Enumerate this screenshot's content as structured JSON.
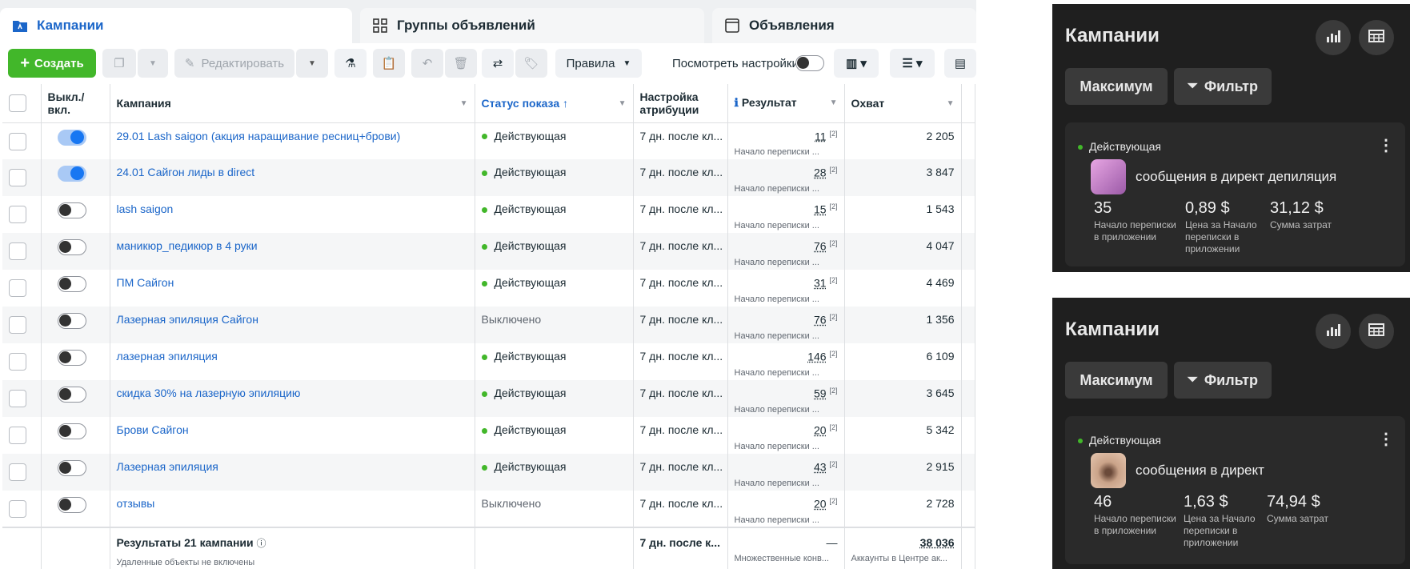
{
  "tabs": {
    "campaigns": "Кампании",
    "adsets": "Группы объявлений",
    "ads": "Объявления"
  },
  "toolbar": {
    "create": "Создать",
    "edit": "Редактировать",
    "rules": "Правила",
    "view_settings": "Посмотреть настройки"
  },
  "table": {
    "headers": {
      "toggle": "Выкл./вкл.",
      "campaign": "Кампания",
      "status": "Статус показа ↑",
      "attribution": "Настройка атрибуции",
      "result": "Результат",
      "reach": "Охват"
    },
    "rows": [
      {
        "on": true,
        "name": "29.01 Lash saigon (акция наращивание ресниц+брови)",
        "status": "Действующая",
        "active": true,
        "attribution": "7 дн. после кл...",
        "result": "11",
        "sup": "[2]",
        "result_label": "Начало переписки ...",
        "reach": "2 205"
      },
      {
        "on": true,
        "name": "24.01 Сайгон лиды в direct",
        "status": "Действующая",
        "active": true,
        "attribution": "7 дн. после кл...",
        "result": "28",
        "sup": "[2]",
        "result_label": "Начало переписки ...",
        "reach": "3 847"
      },
      {
        "on": false,
        "name": "lash saigon",
        "status": "Действующая",
        "active": true,
        "attribution": "7 дн. после кл...",
        "result": "15",
        "sup": "[2]",
        "result_label": "Начало переписки ...",
        "reach": "1 543"
      },
      {
        "on": false,
        "name": "маникюр_педикюр в 4 руки",
        "status": "Действующая",
        "active": true,
        "attribution": "7 дн. после кл...",
        "result": "76",
        "sup": "[2]",
        "result_label": "Начало переписки ...",
        "reach": "4 047"
      },
      {
        "on": false,
        "name": "ПМ Сайгон",
        "status": "Действующая",
        "active": true,
        "attribution": "7 дн. после кл...",
        "result": "31",
        "sup": "[2]",
        "result_label": "Начало переписки ...",
        "reach": "4 469"
      },
      {
        "on": false,
        "name": "Лазерная эпиляция  Сайгон",
        "status": "Выключено",
        "active": false,
        "attribution": "7 дн. после кл...",
        "result": "76",
        "sup": "[2]",
        "result_label": "Начало переписки ...",
        "reach": "1 356"
      },
      {
        "on": false,
        "name": "лазерная эпиляция",
        "status": "Действующая",
        "active": true,
        "attribution": "7 дн. после кл...",
        "result": "146",
        "sup": "[2]",
        "result_label": "Начало переписки ...",
        "reach": "6 109"
      },
      {
        "on": false,
        "name": "скидка 30% на лазерную эпиляцию",
        "status": "Действующая",
        "active": true,
        "attribution": "7 дн. после кл...",
        "result": "59",
        "sup": "[2]",
        "result_label": "Начало переписки ...",
        "reach": "3 645"
      },
      {
        "on": false,
        "name": "Брови Сайгон",
        "status": "Действующая",
        "active": true,
        "attribution": "7 дн. после кл...",
        "result": "20",
        "sup": "[2]",
        "result_label": "Начало переписки ...",
        "reach": "5 342"
      },
      {
        "on": false,
        "name": "Лазерная эпиляция",
        "status": "Действующая",
        "active": true,
        "attribution": "7 дн. после кл...",
        "result": "43",
        "sup": "[2]",
        "result_label": "Начало переписки ...",
        "reach": "2 915"
      },
      {
        "on": false,
        "name": "отзывы",
        "status": "Выключено",
        "active": false,
        "attribution": "7 дн. после кл...",
        "result": "20",
        "sup": "[2]",
        "result_label": "Начало переписки ...",
        "reach": "2 728"
      }
    ],
    "footer": {
      "title": "Результаты 21 кампании",
      "note": "Удаленные объекты не включены",
      "attribution": "7 дн. после к...",
      "result": "—",
      "result_label": "Множественные конв...",
      "reach": "38 036",
      "reach_label": "Аккаунты в Центре ак..."
    }
  },
  "panels": [
    {
      "title": "Кампании",
      "max_button": "Максимум",
      "filter_button": "Фильтр",
      "status": "Действующая",
      "name": "сообщения в директ депиляция",
      "metrics": [
        {
          "value": "35",
          "label": "Начало переписки в приложении"
        },
        {
          "value": "0,89 $",
          "label": "Цена за Начало переписки в приложении"
        },
        {
          "value": "31,12 $",
          "label": "Сумма затрат"
        }
      ],
      "thumb_color": "#c48bc9"
    },
    {
      "title": "Кампании",
      "max_button": "Максимум",
      "filter_button": "Фильтр",
      "status": "Действующая",
      "name": "сообщения в директ",
      "metrics": [
        {
          "value": "46",
          "label": "Начало переписки в приложении"
        },
        {
          "value": "1,63 $",
          "label": "Цена за Начало переписки в приложении"
        },
        {
          "value": "74,94 $",
          "label": "Сумма затрат"
        }
      ],
      "thumb_color": "#b98f76"
    }
  ],
  "colors": {
    "accent": "#1b66c9",
    "create": "#42b72a",
    "active_dot": "#42b72a",
    "panel_bg": "#1f1f1f"
  }
}
